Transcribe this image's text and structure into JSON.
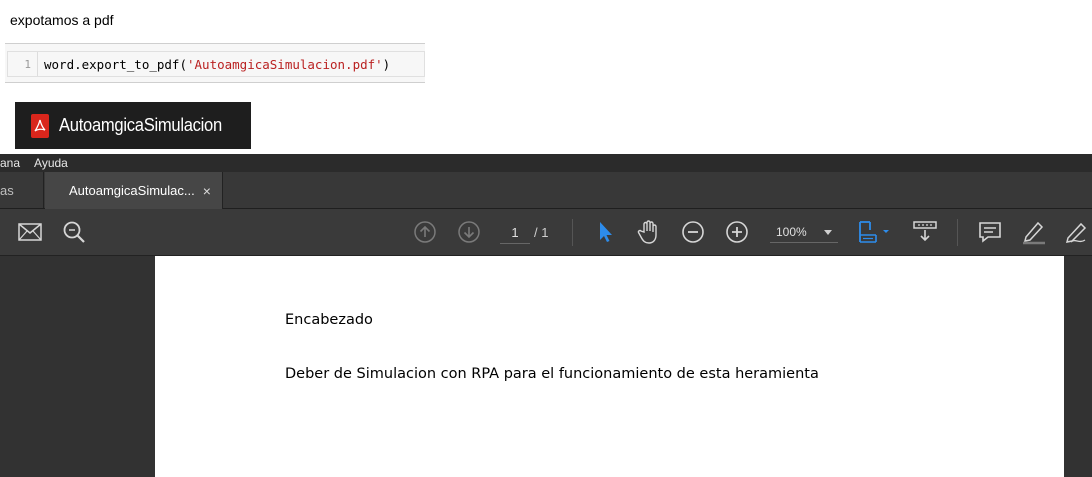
{
  "notebook": {
    "markdown_text": "expotamos a pdf",
    "code_cell": {
      "line_number": "1",
      "code_prefix": "word.export_to_pdf(",
      "code_string": "'AutoamgicaSimulacion.pdf'",
      "code_suffix": ")"
    },
    "file_tile": {
      "icon": "pdf-file-icon",
      "name": "AutoamgicaSimulacion"
    }
  },
  "acrobat": {
    "menu": [
      "ana",
      "Ayuda"
    ],
    "tabs": {
      "left_partial": "as",
      "active_label": "AutoamgicaSimulac...",
      "close_glyph": "×"
    },
    "toolbar": {
      "icons": [
        "mail-icon",
        "search-icon",
        "page-up-icon",
        "page-down-icon",
        "select-cursor-icon",
        "hand-tool-icon",
        "zoom-out-icon",
        "zoom-in-icon",
        "fit-page-icon",
        "scroll-mode-icon",
        "comment-icon",
        "highlight-pen-icon",
        "draw-icon"
      ],
      "current_page": "1",
      "page_total": "/ 1",
      "zoom": "100%",
      "accent_color": "#2d8ceb"
    },
    "document": {
      "heading": "Encabezado",
      "body": "Deber de Simulacion con RPA para el funcionamiento de esta heramienta"
    }
  }
}
